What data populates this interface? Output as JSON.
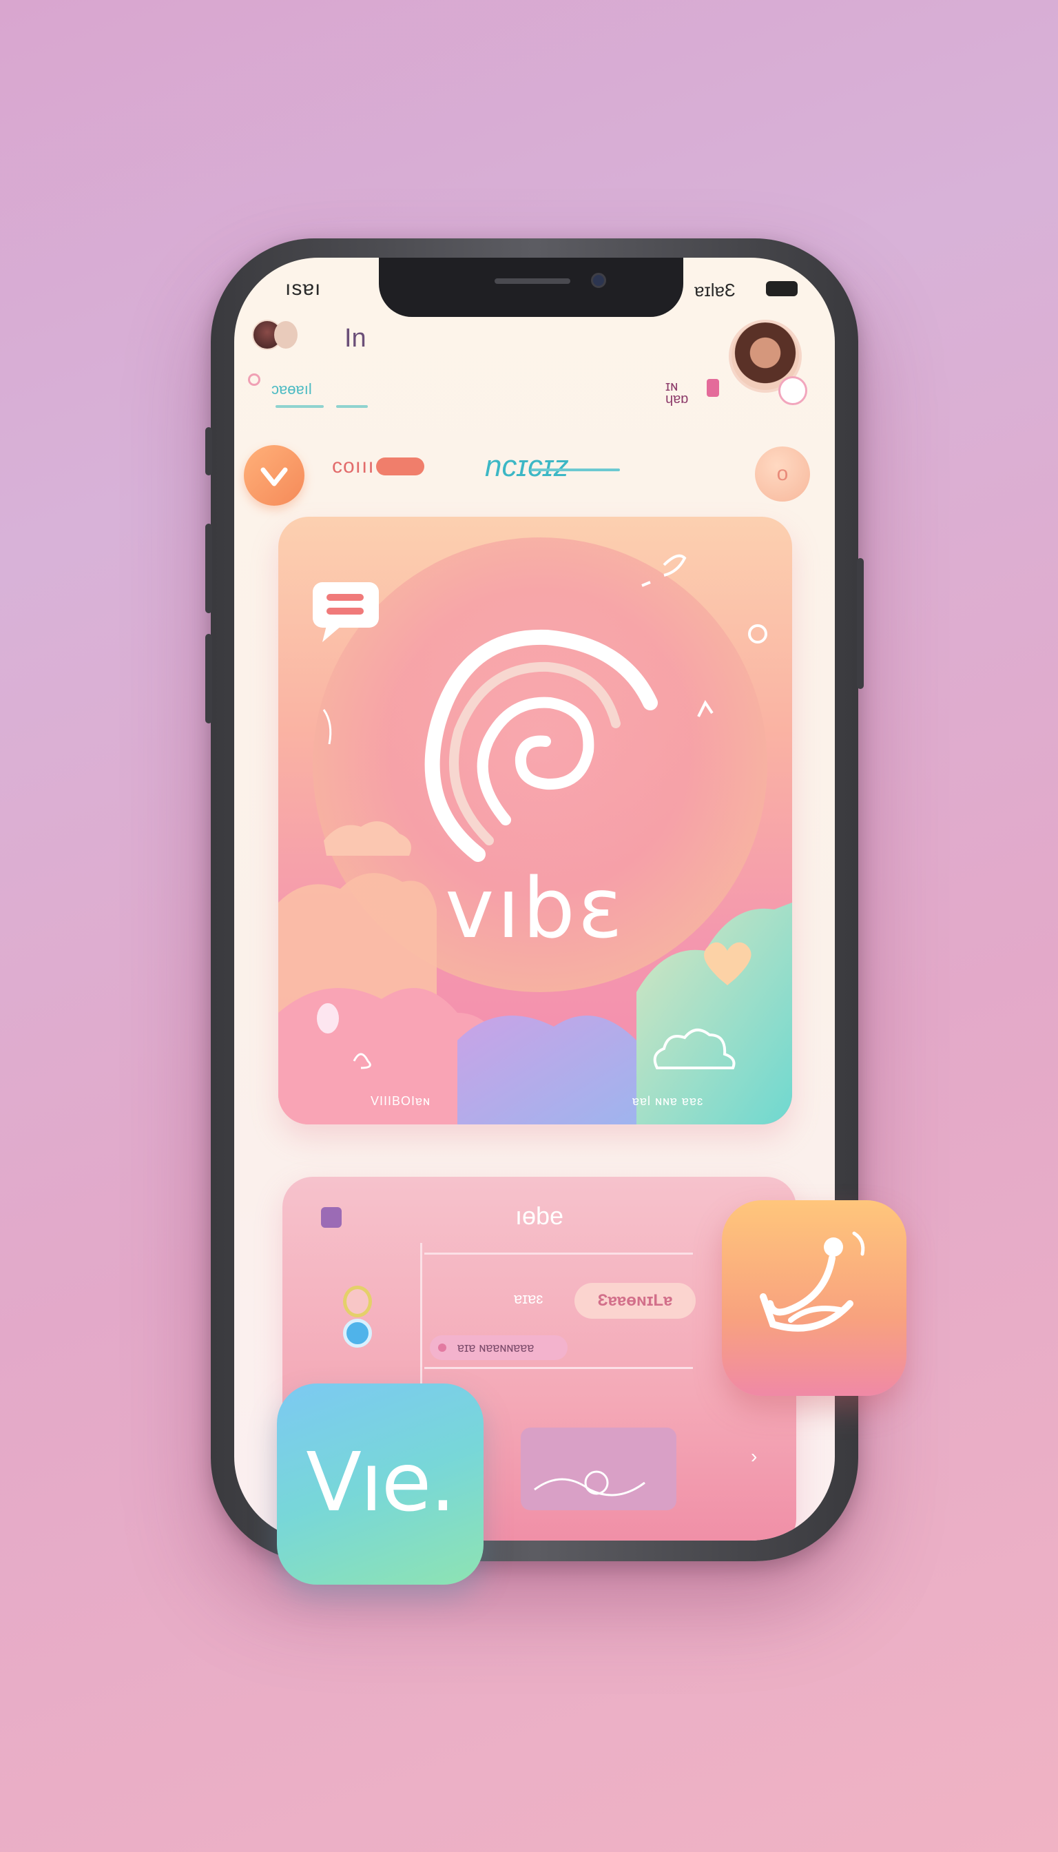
{
  "status_bar": {
    "time": "ısɐı",
    "right_text": "ɐɪlɐƐ"
  },
  "header": {
    "title": "In",
    "subtitle": "ɔɐɵɐıl",
    "hd_label": "ɪɴ\nɥɐɒ"
  },
  "nav": {
    "tab1_label": "coııı",
    "tab2_label": "ncɪcɪz"
  },
  "hero": {
    "title": "vıbɛ",
    "caption_left": "VIIIBOIɐɴ",
    "caption_right": "ɐɐl ɴɴɐ ɐɐɛ"
  },
  "panel": {
    "title": "ıɵbe",
    "label": "ɐɪɐɛ",
    "pill": "ƐɐɐɵɴɪLɐ",
    "tag": "ɐɪɐ ɴɐɐɴɴɐɐɐ",
    "arrow": "›"
  },
  "app_icons": {
    "left_text": "Vıe."
  },
  "icons": {
    "chat": "chat-bubble-icon",
    "logo": "spiral-logo-icon",
    "heart": "heart-icon",
    "cloud": "cloud-icon",
    "arrow_orange": "chevron-down-icon"
  },
  "colors": {
    "accent_orange": "#f58a59",
    "accent_teal": "#3cb7c5",
    "accent_pink": "#f38cad"
  }
}
